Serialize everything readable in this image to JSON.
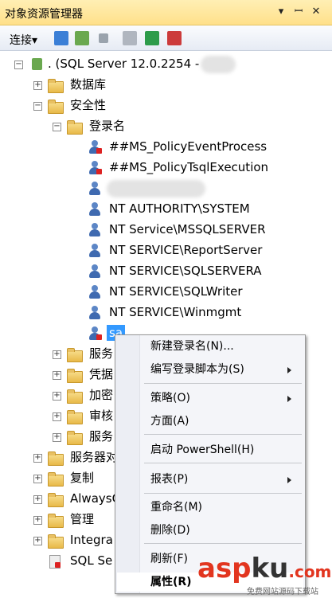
{
  "window": {
    "title": "对象资源管理器",
    "pin": "▾ ꟷ ✕"
  },
  "toolbar": {
    "connect_label": "连接▾"
  },
  "tree": {
    "root": ". (SQL Server 12.0.2254 -",
    "db": "数据库",
    "security": "安全性",
    "logins": "登录名",
    "login_items": [
      "##MS_PolicyEventProcess",
      "##MS_PolicyTsqlExecution",
      "",
      "NT AUTHORITY\\SYSTEM",
      "NT Service\\MSSQLSERVER",
      "NT SERVICE\\ReportServer",
      "NT SERVICE\\SQLSERVERA",
      "NT SERVICE\\SQLWriter",
      "NT SERVICE\\Winmgmt",
      "sa"
    ],
    "sub_folders": [
      "服务",
      "凭据",
      "加密",
      "审核",
      "服务"
    ],
    "top_folders": [
      "服务器对",
      "复制",
      "AlwaysO",
      "管理",
      "Integra"
    ],
    "sql_agent": "SQL Se"
  },
  "menu": {
    "items": [
      "新建登录名(N)...",
      "编写登录脚本为(S)",
      "策略(O)",
      "方面(A)",
      "启动 PowerShell(H)",
      "报表(P)",
      "重命名(M)",
      "删除(D)",
      "刷新(F)",
      "属性(R)"
    ]
  },
  "watermark": {
    "asp": "asp",
    "ku": "ku",
    "cn": ".com",
    "sub": "免费网站源码下载站"
  }
}
